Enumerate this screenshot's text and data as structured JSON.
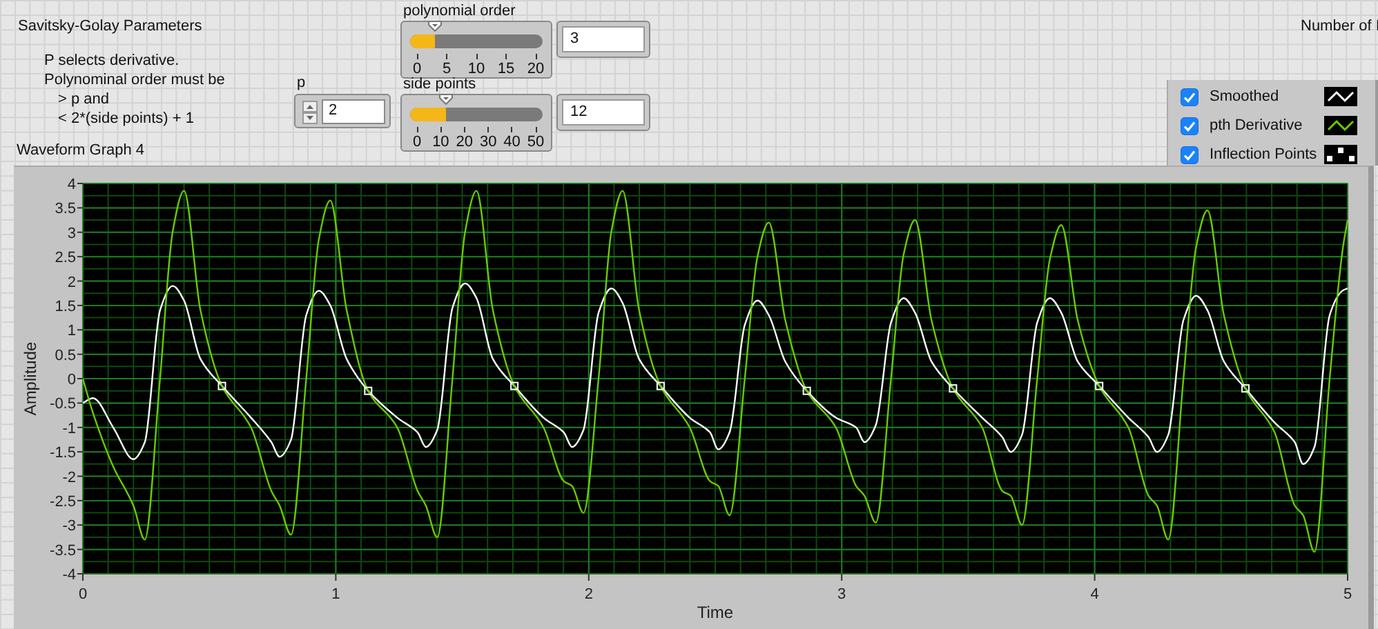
{
  "panel": {
    "title": "Savitsky-Golay Parameters",
    "note": [
      "P selects derivative.",
      "Polynominal order must be",
      "> p and",
      "< 2*(side points) + 1"
    ],
    "side_label": "Number of I"
  },
  "p_control": {
    "label": "p",
    "value": "2"
  },
  "sliders": [
    {
      "label": "polynomial order",
      "level": 0.15,
      "ticks": [
        "0",
        "5",
        "10",
        "15",
        "20"
      ],
      "value": "3"
    },
    {
      "label": "side points",
      "level": 0.24,
      "ticks": [
        "0",
        "10",
        "20",
        "30",
        "40",
        "50"
      ],
      "value": "12"
    }
  ],
  "legend": [
    {
      "checked": true
    },
    {
      "checked": true
    },
    {
      "checked": true
    }
  ],
  "graph": {
    "title": "Waveform Graph 4",
    "chart_data": {
      "type": "line",
      "grid": true,
      "xlabel": "Time",
      "ylabel": "Amplitude",
      "xlim": [
        0,
        5
      ],
      "ylim": [
        -4,
        4
      ],
      "xticks": [
        0,
        1,
        2,
        3,
        4,
        5
      ],
      "yticks": [
        -4,
        -3.5,
        -3,
        -2.5,
        -2,
        -1.5,
        -1,
        -0.5,
        0,
        0.5,
        1,
        1.5,
        2,
        2.5,
        3,
        3.5,
        4
      ],
      "x": [
        0,
        0.04,
        0.12,
        0.2,
        0.245,
        0.305,
        0.355,
        0.4,
        0.465,
        0.55,
        0.665,
        0.745,
        0.778,
        0.823,
        0.883,
        0.933,
        0.978,
        1.043,
        1.128,
        1.243,
        1.323,
        1.356,
        1.401,
        1.461,
        1.511,
        1.556,
        1.621,
        1.706,
        1.821,
        1.901,
        1.934,
        1.979,
        2.039,
        2.089,
        2.134,
        2.199,
        2.284,
        2.399,
        2.479,
        2.512,
        2.557,
        2.617,
        2.667,
        2.712,
        2.777,
        2.862,
        2.977,
        3.057,
        3.09,
        3.135,
        3.195,
        3.245,
        3.29,
        3.355,
        3.44,
        3.555,
        3.635,
        3.668,
        3.713,
        3.773,
        3.823,
        3.868,
        3.933,
        4.018,
        4.133,
        4.213,
        4.246,
        4.291,
        4.351,
        4.401,
        4.446,
        4.511,
        4.596,
        4.711,
        4.791,
        4.824,
        4.869,
        4.929,
        4.979,
        5
      ],
      "series": [
        {
          "name": "Smoothed",
          "color": "#ffffff",
          "values": [
            -0.5,
            -0.4,
            -1.0,
            -1.65,
            -1.3,
            1.4,
            1.9,
            1.6,
            0.4,
            -0.15,
            -0.8,
            -1.3,
            -1.6,
            -1.25,
            1.3,
            1.8,
            1.5,
            0.4,
            -0.25,
            -0.8,
            -1.1,
            -1.4,
            -1.05,
            1.45,
            1.95,
            1.65,
            0.4,
            -0.15,
            -0.8,
            -1.1,
            -1.4,
            -1.05,
            1.35,
            1.85,
            1.55,
            0.4,
            -0.15,
            -0.8,
            -1.1,
            -1.45,
            -1.1,
            1.1,
            1.6,
            1.3,
            0.35,
            -0.25,
            -0.8,
            -1,
            -1.3,
            -0.95,
            1.15,
            1.65,
            1.35,
            0.35,
            -0.2,
            -0.8,
            -1.2,
            -1.5,
            -1.15,
            1.15,
            1.65,
            1.35,
            0.35,
            -0.15,
            -0.8,
            -1.2,
            -1.5,
            -1.15,
            1.2,
            1.7,
            1.4,
            0.35,
            -0.2,
            -0.9,
            -1.3,
            -1.75,
            -1.4,
            1.3,
            1.8,
            1.85
          ]
        },
        {
          "name": "pth Derivative",
          "color": "#66cc00",
          "values": [
            0,
            -0.7,
            -1.8,
            -2.6,
            -3.3,
            0,
            3,
            3.85,
            1.4,
            -0.15,
            -1,
            -2.3,
            -2.6,
            -3.2,
            0,
            2.85,
            3.65,
            1.4,
            -0.25,
            -1,
            -2.3,
            -2.6,
            -3.25,
            0,
            3,
            3.85,
            1.4,
            -0.15,
            -1,
            -2.1,
            -2.2,
            -2.75,
            0,
            3,
            3.85,
            1.4,
            -0.15,
            -1,
            -2.1,
            -2.2,
            -2.8,
            0,
            2.5,
            3.2,
            1.2,
            -0.25,
            -1,
            -2.2,
            -2.4,
            -2.95,
            0,
            2.55,
            3.25,
            1.2,
            -0.2,
            -1,
            -2.3,
            -2.4,
            -3,
            0,
            2.45,
            3.15,
            1.2,
            -0.15,
            -1,
            -2.4,
            -2.6,
            -3.3,
            0,
            2.7,
            3.45,
            1.3,
            -0.2,
            -1.1,
            -2.6,
            -2.8,
            -3.55,
            0,
            2.6,
            3.25
          ]
        },
        {
          "name": "Inflection Points",
          "color": "#ffffff",
          "type": "scatter",
          "values": [
            null,
            null,
            null,
            null,
            null,
            null,
            null,
            null,
            null,
            -0.15,
            null,
            null,
            null,
            null,
            null,
            null,
            null,
            null,
            -0.25,
            null,
            null,
            null,
            null,
            null,
            null,
            null,
            null,
            -0.15,
            null,
            null,
            null,
            null,
            null,
            null,
            null,
            null,
            -0.15,
            null,
            null,
            null,
            null,
            null,
            null,
            null,
            null,
            -0.25,
            null,
            null,
            null,
            null,
            null,
            null,
            null,
            null,
            -0.2,
            null,
            null,
            null,
            null,
            null,
            null,
            null,
            null,
            -0.15,
            null,
            null,
            null,
            null,
            null,
            null,
            null,
            null,
            -0.2,
            null,
            null,
            null,
            null,
            null,
            null,
            null
          ]
        }
      ]
    }
  }
}
